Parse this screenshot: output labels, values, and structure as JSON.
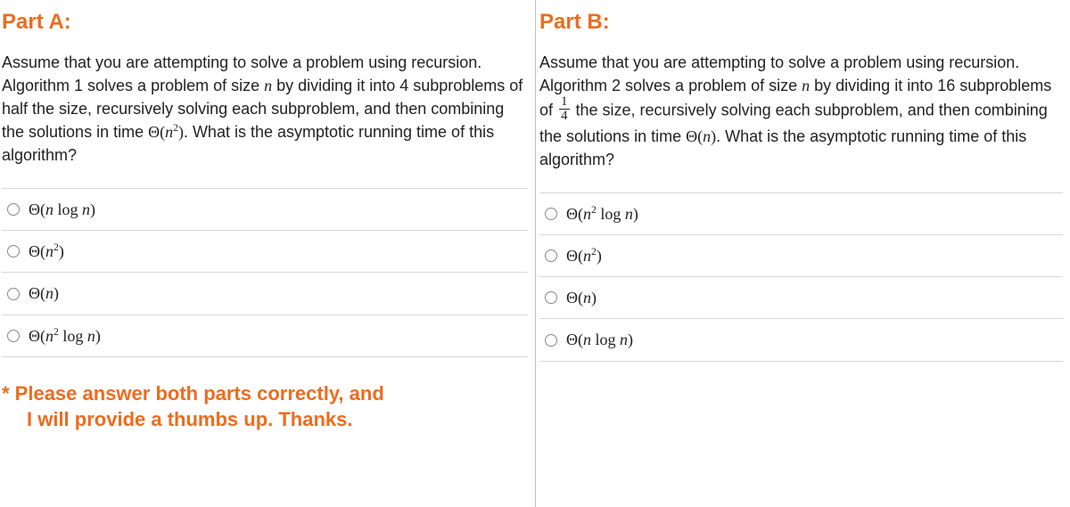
{
  "partA": {
    "heading": "Part A:",
    "prompt": {
      "t1": "Assume that you are attempting to solve a problem using recursion. Algorithm 1 solves a problem of size ",
      "n1": "n",
      "t2": " by dividing it into 4 subproblems of half the size, recursively solving each subproblem, and then combining the solutions in time ",
      "theta": "Θ(",
      "n2": "n",
      "exp": "2",
      "close": ")",
      "t3": ". What is the asymptotic running time of this algorithm?"
    },
    "options": [
      {
        "theta": "Θ(",
        "inner_html": "<span class=\"math-it\">n</span> log <span class=\"math-it\">n</span>",
        "close": ")"
      },
      {
        "theta": "Θ(",
        "inner_html": "<span class=\"math-it\">n</span><sup>2</sup>",
        "close": ")"
      },
      {
        "theta": "Θ(",
        "inner_html": "<span class=\"math-it\">n</span>",
        "close": ")"
      },
      {
        "theta": "Θ(",
        "inner_html": "<span class=\"math-it\">n</span><sup>2</sup> log <span class=\"math-it\">n</span>",
        "close": ")"
      }
    ]
  },
  "partB": {
    "heading": "Part B:",
    "prompt": {
      "t1": "Assume that you are attempting to solve a problem using recursion. Algorithm 2 solves a problem of size ",
      "n1": "n",
      "t2": " by dividing it into 16 subproblems of ",
      "frac_num": "1",
      "frac_den": "4",
      "t3": " the size, recursively solving each subproblem, and then combining the solutions in time ",
      "theta": "Θ(",
      "n2": "n",
      "close": ")",
      "t4": ". What is the asymptotic running time of this algorithm?"
    },
    "options": [
      {
        "theta": "Θ(",
        "inner_html": "<span class=\"math-it\">n</span><sup>2</sup> log <span class=\"math-it\">n</span>",
        "close": ")"
      },
      {
        "theta": "Θ(",
        "inner_html": "<span class=\"math-it\">n</span><sup>2</sup>",
        "close": ")"
      },
      {
        "theta": "Θ(",
        "inner_html": "<span class=\"math-it\">n</span>",
        "close": ")"
      },
      {
        "theta": "Θ(",
        "inner_html": "<span class=\"math-it\">n</span> log <span class=\"math-it\">n</span>",
        "close": ")"
      }
    ]
  },
  "note": {
    "line1": "* Please answer both parts correctly, and",
    "line2": "I will provide a thumbs up. Thanks."
  }
}
